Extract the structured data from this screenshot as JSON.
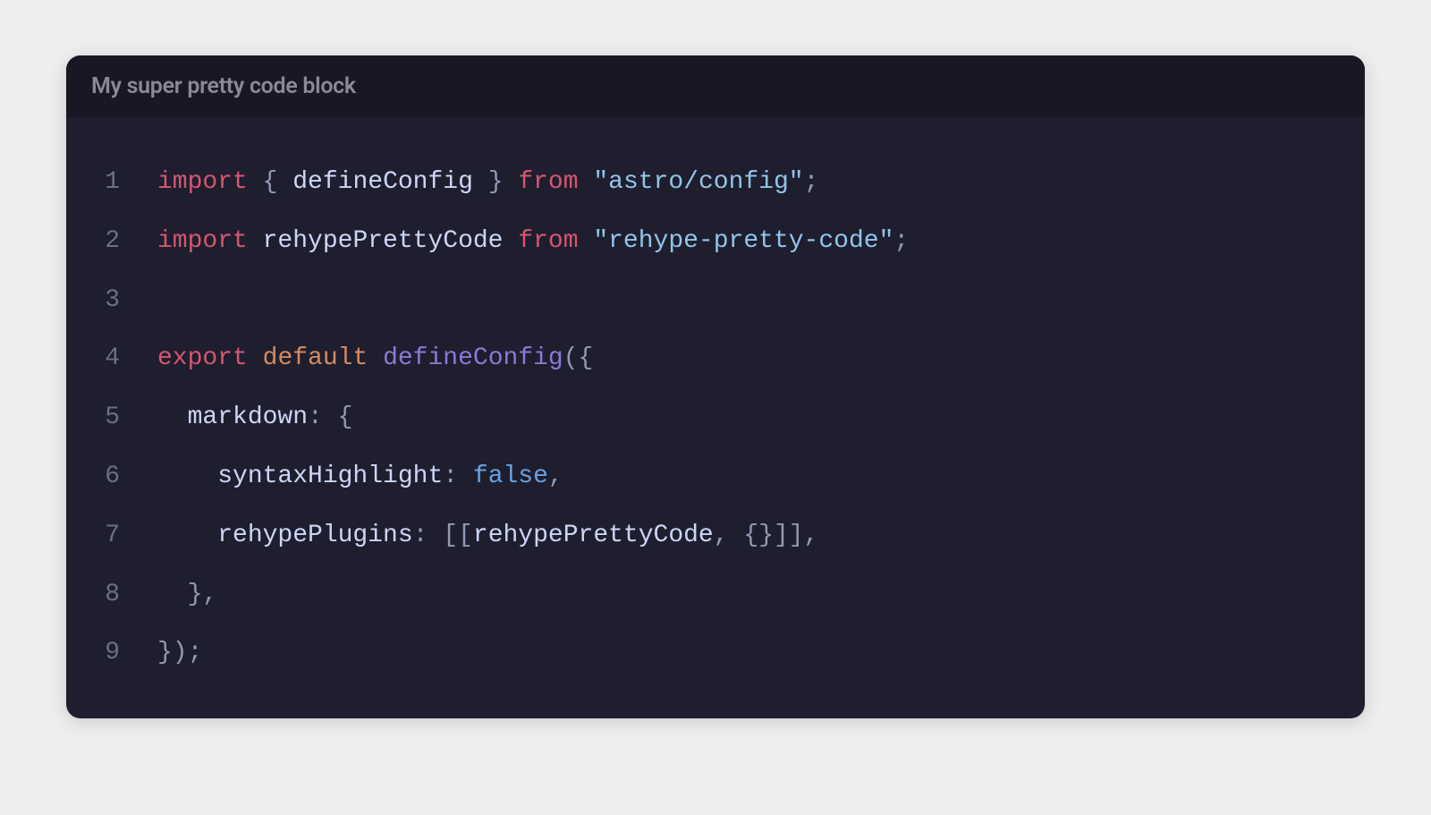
{
  "title": "My super pretty code block",
  "colors": {
    "page_bg": "#eeeeee",
    "block_bg": "#1e1e2e",
    "header_bg": "#181825",
    "header_text": "#8a8a94",
    "line_number": "#6c6f85",
    "keyword_red": "#d65670",
    "keyword_orange": "#d68a60",
    "identifier": "#cdd6f4",
    "string": "#93c4e8",
    "punct": "#9399b2",
    "function": "#8a7ad6",
    "boolean": "#6aa0e0"
  },
  "lines": [
    {
      "num": "1",
      "tokens": [
        {
          "t": "import",
          "c": "tok-kw"
        },
        {
          "t": " ",
          "c": "tok-id"
        },
        {
          "t": "{",
          "c": "tok-punct"
        },
        {
          "t": " defineConfig ",
          "c": "tok-id"
        },
        {
          "t": "}",
          "c": "tok-punct"
        },
        {
          "t": " ",
          "c": "tok-id"
        },
        {
          "t": "from",
          "c": "tok-kw"
        },
        {
          "t": " ",
          "c": "tok-id"
        },
        {
          "t": "\"astro/config\"",
          "c": "tok-str"
        },
        {
          "t": ";",
          "c": "tok-punct"
        }
      ]
    },
    {
      "num": "2",
      "tokens": [
        {
          "t": "import",
          "c": "tok-kw"
        },
        {
          "t": " rehypePrettyCode ",
          "c": "tok-id"
        },
        {
          "t": "from",
          "c": "tok-kw"
        },
        {
          "t": " ",
          "c": "tok-id"
        },
        {
          "t": "\"rehype-pretty-code\"",
          "c": "tok-str"
        },
        {
          "t": ";",
          "c": "tok-punct"
        }
      ]
    },
    {
      "num": "3",
      "tokens": []
    },
    {
      "num": "4",
      "tokens": [
        {
          "t": "export",
          "c": "tok-kw"
        },
        {
          "t": " ",
          "c": "tok-id"
        },
        {
          "t": "default",
          "c": "tok-kw2"
        },
        {
          "t": " ",
          "c": "tok-id"
        },
        {
          "t": "defineConfig",
          "c": "tok-fn"
        },
        {
          "t": "({",
          "c": "tok-punct"
        }
      ]
    },
    {
      "num": "5",
      "tokens": [
        {
          "t": "  markdown",
          "c": "tok-id"
        },
        {
          "t": ":",
          "c": "tok-punct"
        },
        {
          "t": " ",
          "c": "tok-id"
        },
        {
          "t": "{",
          "c": "tok-punct"
        }
      ]
    },
    {
      "num": "6",
      "tokens": [
        {
          "t": "    syntaxHighlight",
          "c": "tok-id"
        },
        {
          "t": ":",
          "c": "tok-punct"
        },
        {
          "t": " ",
          "c": "tok-id"
        },
        {
          "t": "false",
          "c": "tok-bool"
        },
        {
          "t": ",",
          "c": "tok-punct"
        }
      ]
    },
    {
      "num": "7",
      "tokens": [
        {
          "t": "    rehypePlugins",
          "c": "tok-id"
        },
        {
          "t": ":",
          "c": "tok-punct"
        },
        {
          "t": " ",
          "c": "tok-id"
        },
        {
          "t": "[[",
          "c": "tok-punct"
        },
        {
          "t": "rehypePrettyCode",
          "c": "tok-id"
        },
        {
          "t": ",",
          "c": "tok-punct"
        },
        {
          "t": " ",
          "c": "tok-id"
        },
        {
          "t": "{}]],",
          "c": "tok-punct"
        }
      ]
    },
    {
      "num": "8",
      "tokens": [
        {
          "t": "  ",
          "c": "tok-id"
        },
        {
          "t": "},",
          "c": "tok-punct"
        }
      ]
    },
    {
      "num": "9",
      "tokens": [
        {
          "t": "});",
          "c": "tok-punct"
        }
      ]
    }
  ]
}
